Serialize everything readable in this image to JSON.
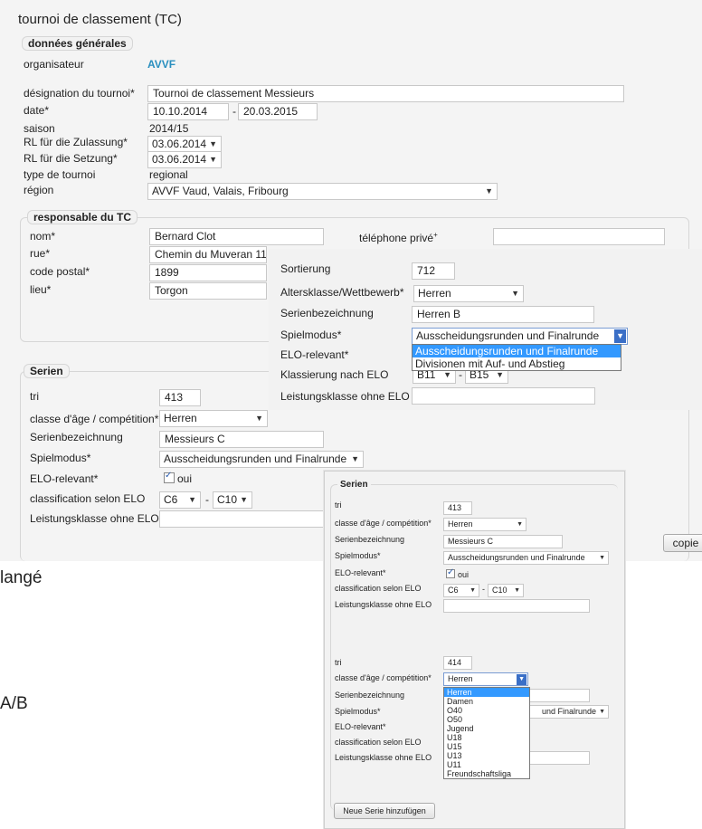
{
  "page_title": "tournoi de classement (TC)",
  "general": {
    "legend": "données générales",
    "organisateur_label": "organisateur",
    "organisateur_value": "AVVF",
    "designation_label": "désignation du tournoi*",
    "designation_value": "Tournoi de classement Messieurs",
    "date_label": "date*",
    "date_from": "10.10.2014",
    "date_sep": "-",
    "date_to": "20.03.2015",
    "saison_label": "saison",
    "saison_value": "2014/15",
    "rl_zulassung_label": "RL für die Zulassung*",
    "rl_zulassung_value": "03.06.2014",
    "rl_setzung_label": "RL für die Setzung*",
    "rl_setzung_value": "03.06.2014",
    "type_label": "type de tournoi",
    "type_value": "regional",
    "region_label": "région",
    "region_value": "AVVF Vaud, Valais, Fribourg"
  },
  "responsable": {
    "legend": "responsable du TC",
    "nom_label": "nom*",
    "nom_value": "Bernard Clot",
    "telephone_label": "téléphone privé",
    "telephone_sup": "+",
    "telephone_value": "",
    "rue_label": "rue*",
    "rue_value": "Chemin du Muveran 11",
    "cp_label": "code postal*",
    "cp_value": "1899",
    "lieu_label": "lieu*",
    "lieu_value": "Torgon"
  },
  "serien": {
    "legend": "Serien",
    "tri_label": "tri",
    "tri_value": "413",
    "classe_label": "classe d'âge / compétition*",
    "classe_value": "Herren",
    "bez_label": "Serienbezeichnung",
    "bez_value": "Messieurs C",
    "modus_label": "Spielmodus*",
    "modus_value": "Ausscheidungsrunden und Finalrunde",
    "elo_label": "ELO-relevant*",
    "elo_value": "oui",
    "class_elo_label": "classification selon ELO",
    "class_elo_from": "C6",
    "class_elo_sep": "-",
    "class_elo_to": "C10",
    "lk_label": "Leistungsklasse ohne ELO",
    "lk_value": "",
    "copy_button": "copie"
  },
  "left_fragments": {
    "frag1": "langé",
    "frag2": "A/B"
  },
  "overlay_de": {
    "sort_label": "Sortierung",
    "sort_value": "712",
    "alters_label": "Altersklasse/Wettbewerb*",
    "alters_value": "Herren",
    "bez_label": "Serienbezeichnung",
    "bez_value": "Herren B",
    "modus_label": "Spielmodus*",
    "modus_value": "Ausscheidungsrunden und Finalrunde",
    "modus_options": [
      "Ausscheidungsrunden und Finalrunde",
      "Divisionen mit Auf- und Abstieg"
    ],
    "elo_label": "ELO-relevant*",
    "klass_label": "Klassierung nach ELO",
    "klass_from": "B11",
    "klass_sep": "-",
    "klass_to": "B15",
    "lk_label": "Leistungsklasse ohne ELO",
    "lk_value": ""
  },
  "overlay_serien": {
    "legend": "Serien",
    "s1": {
      "tri_label": "tri",
      "tri_value": "413",
      "classe_label": "classe d'âge / compétition*",
      "classe_value": "Herren",
      "bez_label": "Serienbezeichnung",
      "bez_value": "Messieurs C",
      "modus_label": "Spielmodus*",
      "modus_value": "Ausscheidungsrunden und Finalrunde",
      "elo_label": "ELO-relevant*",
      "elo_value": "oui",
      "class_elo_label": "classification selon ELO",
      "class_elo_from": "C6",
      "class_elo_sep": "-",
      "class_elo_to": "C10",
      "lk_label": "Leistungsklasse ohne ELO"
    },
    "s2": {
      "tri_label": "tri",
      "tri_value": "414",
      "classe_label": "classe d'âge / compétition*",
      "classe_value": "Herren",
      "bez_label": "Serienbezeichnung",
      "modus_label": "Spielmodus*",
      "modus_value_tail": "und Finalrunde",
      "elo_label": "ELO-relevant*",
      "class_elo_label": "classification selon ELO",
      "lk_label": "Leistungsklasse ohne ELO",
      "classe_options": [
        "Herren",
        "Damen",
        "O40",
        "O50",
        "Jugend",
        "U18",
        "U15",
        "U13",
        "U11",
        "Freundschaftsliga"
      ]
    },
    "add_button": "Neue Serie hinzufügen"
  }
}
